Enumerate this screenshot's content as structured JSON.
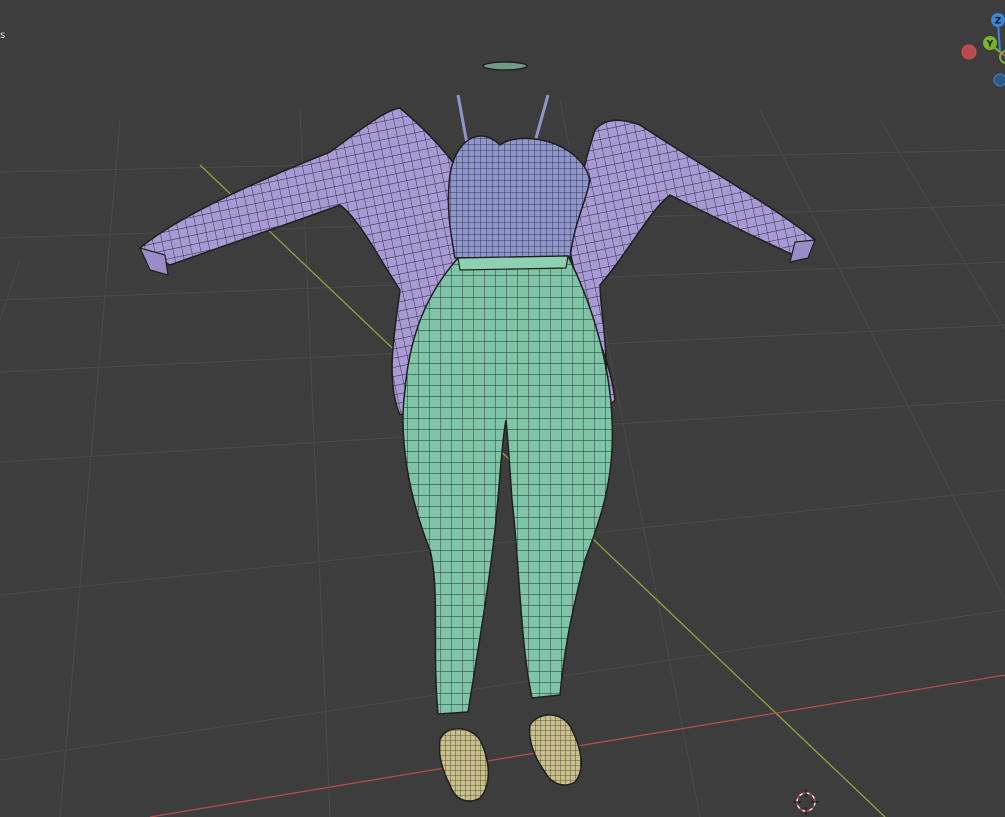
{
  "viewport": {
    "corner_text": "s"
  },
  "gizmo": {
    "z_label": "Z",
    "y_label": "Y",
    "colors": {
      "x": "#e0505a",
      "y": "#7bb12e",
      "z": "#3a86d4"
    }
  },
  "scene": {
    "background": "#3d3d3d",
    "x_axis_color": "#b84a4a",
    "y_axis_color": "#8aa63c",
    "grid_color": "#4a4a4a",
    "jacket_color": "#a99ad6",
    "top_color": "#8e95cf",
    "pants_color": "#7fc4a6",
    "shoes_color": "#c9c08e",
    "wire_color": "#1e1e1e"
  }
}
